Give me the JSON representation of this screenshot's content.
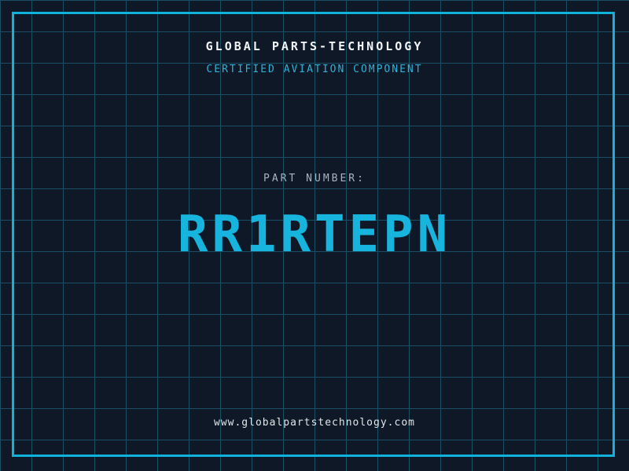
{
  "header": {
    "company": "GLOBAL PARTS-TECHNOLOGY",
    "tagline": "CERTIFIED AVIATION COMPONENT"
  },
  "part": {
    "label": "PART NUMBER:",
    "number": "RR1RTEPN"
  },
  "footer": {
    "website": "www.globalpartstechnology.com"
  },
  "colors": {
    "background": "#0f1827",
    "grid_line": "#1a4f66",
    "frame_accent": "#10b2da",
    "company_text": "#f2f5f8",
    "tagline_text": "#2fb0d6",
    "part_label_text": "#a9b2c0",
    "part_number_text": "#17b4de",
    "website_text": "#e0e6ea"
  }
}
